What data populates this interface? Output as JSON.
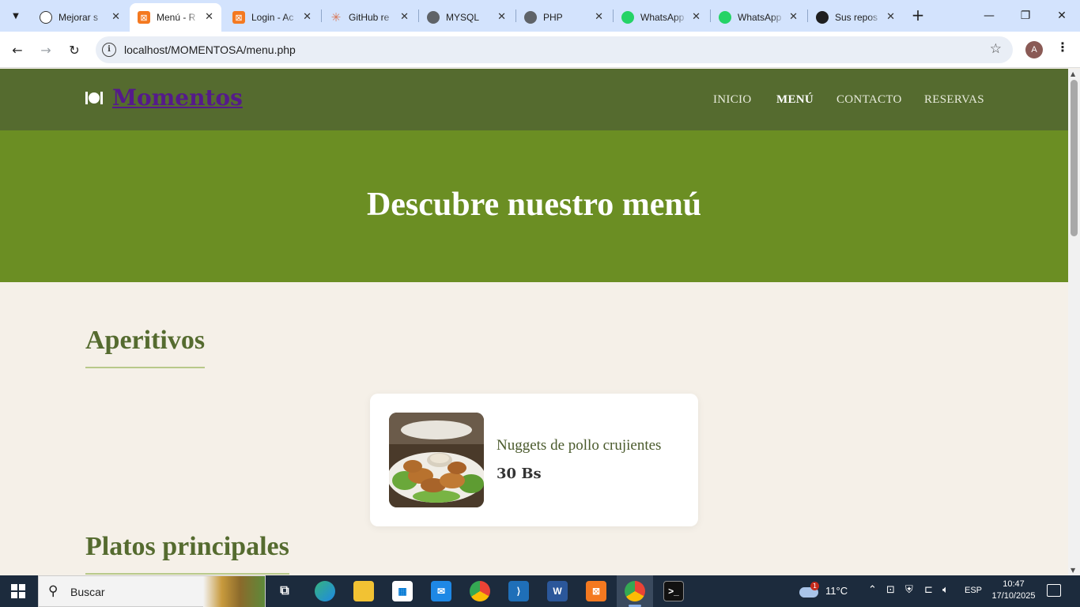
{
  "browser": {
    "tabs": [
      {
        "title": "Mejorar s",
        "icon": "chatgpt-icon",
        "active": false
      },
      {
        "title": "Menú - R",
        "icon": "xampp-icon",
        "active": true
      },
      {
        "title": "Login - Ac",
        "icon": "xampp-icon",
        "active": false
      },
      {
        "title": "GitHub re",
        "icon": "claude-icon",
        "active": false
      },
      {
        "title": "MYSQL",
        "icon": "globe-icon",
        "active": false
      },
      {
        "title": "PHP",
        "icon": "globe-icon",
        "active": false
      },
      {
        "title": "WhatsApp",
        "icon": "whatsapp-icon",
        "active": false
      },
      {
        "title": "WhatsApp",
        "icon": "whatsapp-icon",
        "active": false
      },
      {
        "title": "Sus repos",
        "icon": "github-icon",
        "active": false
      }
    ],
    "url": "localhost/MOMENTOSA/menu.php",
    "profile_initial": "A"
  },
  "site": {
    "logo": "Momentos",
    "nav": [
      "INICIO",
      "MENÚ",
      "CONTACTO",
      "RESERVAS"
    ],
    "active_nav": "MENÚ",
    "hero_title": "Descubre nuestro menú",
    "sections": [
      {
        "title": "Aperitivos",
        "items": [
          {
            "name": "Nuggets de pollo crujientes",
            "price": "30 Bs"
          }
        ]
      },
      {
        "title": "Platos principales",
        "items": []
      }
    ]
  },
  "taskbar": {
    "search_placeholder": "Buscar",
    "weather": {
      "temp": "11°C",
      "badge": "1"
    },
    "language": "ESP",
    "time": "10:47",
    "date": "17/10/2025"
  },
  "colors": {
    "header": "#556b2f",
    "hero": "#6b8e23",
    "page_bg": "#f5f0e8",
    "logo": "#551a8b"
  }
}
